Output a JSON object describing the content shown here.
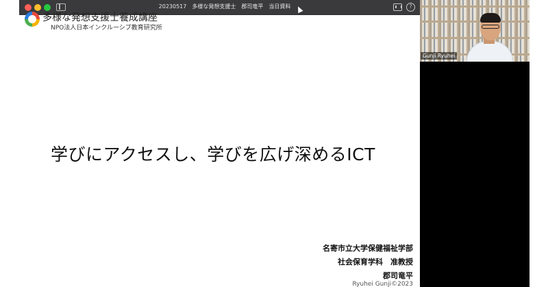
{
  "window": {
    "title": "20230517　多様な発想支援士　郡司竜平　当日資料"
  },
  "toolbar": {
    "help_glyph": "?"
  },
  "slide": {
    "course_title": "多様な発想支援士養成講座",
    "org_name": "NPO法人日本インクルーシブ教育研究所",
    "main_title": "学びにアクセスし、学びを広げ深めるICT",
    "affiliation_lines": [
      "名寄市立大学保健福祉学部",
      "社会保育学科　准教授",
      "郡司竜平",
      "Ryuhei Gunji©2023"
    ]
  },
  "participant": {
    "name": "Gunji Ryuhei"
  },
  "icons": {
    "window_controls": [
      "close-icon",
      "minimize-icon",
      "maximize-icon"
    ],
    "toolbar": [
      "sidebar-toggle-icon",
      "view-layout-icon",
      "help-icon"
    ],
    "pointer": "cursor-icon"
  },
  "colors": {
    "titlebar": "#3a3a3c",
    "background": "#000000",
    "slide": "#ffffff",
    "close": "#ff5f57",
    "minimize": "#febc2e",
    "maximize": "#28c840"
  }
}
